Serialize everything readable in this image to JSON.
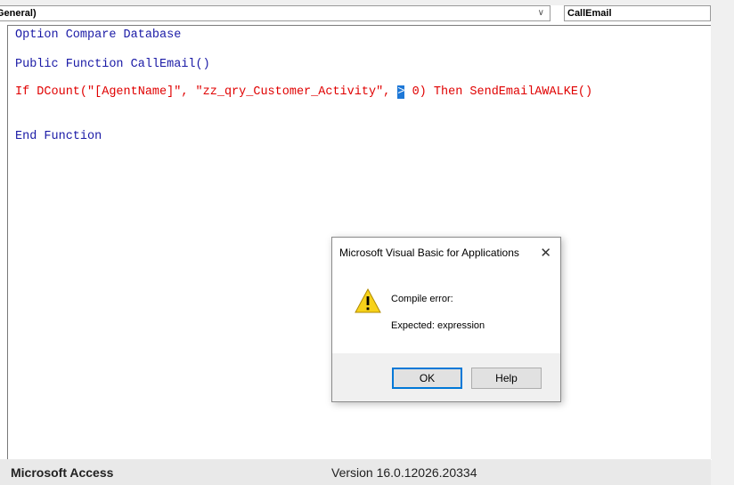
{
  "toolbar": {
    "object_combo": "General)",
    "procedure_combo": "CallEmail",
    "dropdown_arrow": "∨"
  },
  "code": {
    "lines": [
      "Option Compare Database",
      "Public Function CallEmail()",
      "If DCount(\"[AgentName]\", \"zz_qry_Customer_Activity\", ",
      ">",
      " 0) Then SendEmailAWALKE()",
      "End Function"
    ]
  },
  "dialog": {
    "title": "Microsoft Visual Basic for Applications",
    "close_glyph": "✕",
    "message_heading": "Compile error:",
    "message_detail": "Expected: expression",
    "ok_label": "OK",
    "help_label": "Help",
    "icon": "warning-icon"
  },
  "status_bar": {
    "app_name": "Microsoft Access",
    "version": "Version 16.0.12026.20334"
  },
  "colors": {
    "keyword_blue": "#1a1aa6",
    "error_red": "#e00000",
    "selection_blue": "#1e78d7",
    "warning_yellow": "#f7d21a"
  }
}
